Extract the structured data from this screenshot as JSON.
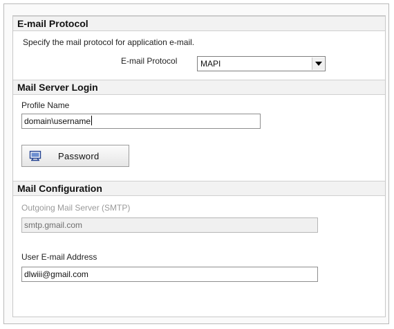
{
  "email_protocol": {
    "header": "E-mail Protocol",
    "description": "Specify the mail protocol for application e-mail.",
    "label": "E-mail Protocol",
    "selected_value": "MAPI"
  },
  "mail_server_login": {
    "header": "Mail Server Login",
    "profile_label": "Profile Name",
    "profile_value": "domain\\username",
    "password_button": "Password",
    "password_icon": "password-icon"
  },
  "mail_configuration": {
    "header": "Mail Configuration",
    "smtp_label": "Outgoing Mail Server (SMTP)",
    "smtp_value": "smtp.gmail.com",
    "email_label": "User E-mail Address",
    "email_value": "dlwiii@gmail.com"
  },
  "colors": {
    "header_bg": "#f2f2f2",
    "disabled_text": "#9a9a9a",
    "border": "#c8c8c8"
  }
}
